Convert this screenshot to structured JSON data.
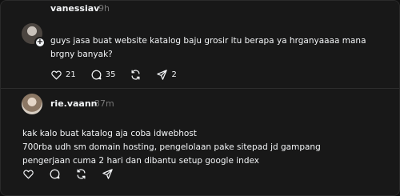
{
  "thread": {
    "post1": {
      "username": "vanessiav",
      "time": "9h",
      "text": "guys jasa buat website katalog baju grosir itu berapa ya hrganyaaaa mana\nbrgny banyak?",
      "likes": "21",
      "comments": "35",
      "reposts": "",
      "shares": "2"
    },
    "post2": {
      "username": "rie.vaann",
      "time": "37m",
      "text": "kak kalo buat katalog aja coba idwebhost\n700rba udh sm domain hosting, pengelolaan pake sitepad jd gampang\npengerjaan cuma 2 hari dan dibantu setup google index",
      "likes": "",
      "comments": "",
      "reposts": "",
      "shares": ""
    }
  },
  "icons": {
    "like": "heart-icon",
    "comment": "comment-icon",
    "repost": "repost-icon",
    "share": "share-icon",
    "follow": "plus-icon"
  },
  "colors": {
    "background": "#181818",
    "text": "#f3f5f7",
    "muted": "#777777",
    "divider": "#2d2d2d"
  }
}
